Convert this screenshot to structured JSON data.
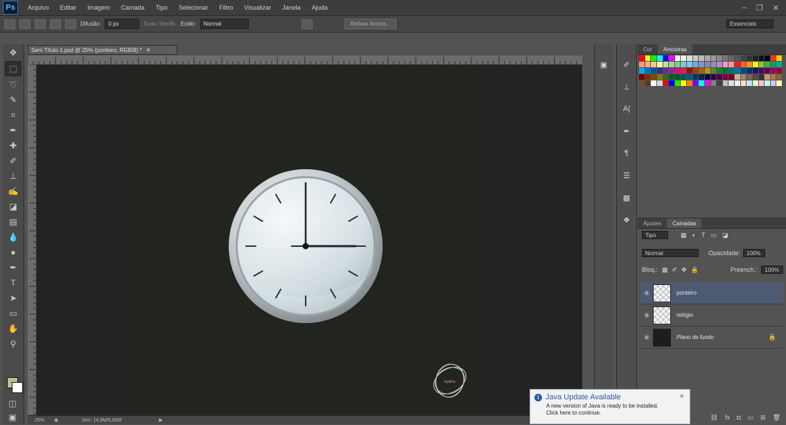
{
  "app": {
    "logo": "Ps"
  },
  "menubar": {
    "items": [
      "Arquivo",
      "Editar",
      "Imagem",
      "Camada",
      "Tipo",
      "Selecionar",
      "Filtro",
      "Visualizar",
      "Janela",
      "Ajuda"
    ]
  },
  "options": {
    "feather_label": "Difusão:",
    "feather_value": "0 px",
    "antialias_label": "Suav. Serrilh.",
    "style_label": "Estilo:",
    "style_value": "Normal",
    "refine_button": "Refinar Aresta...",
    "workspace": "Essenciais"
  },
  "document": {
    "tab_title": "Sem Título-1.psd @ 25% (ponteiro, RGB/8) *",
    "status_zoom": "25%",
    "status_doc": "Doc: 14,9M/5,00M"
  },
  "swatches": {
    "tabs": [
      "Cor",
      "Amostras"
    ],
    "colors": [
      "#ff0000",
      "#ffff00",
      "#00ff00",
      "#00ffff",
      "#0000ff",
      "#ff00ff",
      "#ffffff",
      "#eeeeee",
      "#dddddd",
      "#cccccc",
      "#bbbbbb",
      "#aaaaaa",
      "#999999",
      "#888888",
      "#777777",
      "#666666",
      "#555555",
      "#444444",
      "#333333",
      "#222222",
      "#111111",
      "#000000",
      "#ff3300",
      "#ffcc00",
      "#f7977a",
      "#f9ad81",
      "#fdc68a",
      "#fff79a",
      "#c4df9b",
      "#a2d39c",
      "#82ca9d",
      "#7bcdc8",
      "#6ecff6",
      "#7ea7d8",
      "#8493ca",
      "#8882be",
      "#a187be",
      "#bc8dbf",
      "#f49ac2",
      "#f6989d",
      "#ed1c24",
      "#f26522",
      "#f7941d",
      "#fff200",
      "#8dc73f",
      "#39b54a",
      "#00a651",
      "#00a99d",
      "#00aeef",
      "#0072bc",
      "#0054a6",
      "#2e3192",
      "#662d91",
      "#92278f",
      "#ec008c",
      "#ed145b",
      "#9e0b0f",
      "#a0410d",
      "#a36209",
      "#aba000",
      "#598527",
      "#1a7b30",
      "#007236",
      "#00746b",
      "#0076a3",
      "#004b80",
      "#003471",
      "#1b1464",
      "#440e62",
      "#630460",
      "#9e005d",
      "#9e0039",
      "#790000",
      "#7b2e00",
      "#7d4900",
      "#827b00",
      "#406618",
      "#005e20",
      "#005826",
      "#005952",
      "#005b7f",
      "#003663",
      "#002157",
      "#0d004c",
      "#32004b",
      "#4b0049",
      "#7b0046",
      "#7a0026",
      "#c7b299",
      "#998675",
      "#736357",
      "#534741",
      "#37302c",
      "#c69c6d",
      "#a67c52",
      "#8c6239",
      "#754c24",
      "#603913",
      "#ffffff",
      "#d7d7d7",
      "#ff0000",
      "#0000ff",
      "#00ff00",
      "#ffff00",
      "#ff8000",
      "#8000ff",
      "#00ffff",
      "#ff00ff",
      "#808080",
      "#404040",
      "#c0c0c0",
      "#e0e0e0",
      "#f0f0f0",
      "#ffe0c0",
      "#c0e0ff",
      "#e0ffc0",
      "#ffc0e0",
      "#c0ffe0",
      "#e0c0ff",
      "#ffffc0"
    ]
  },
  "layers_panel": {
    "tabs": [
      "Ajustes",
      "Camadas"
    ],
    "kind_filter": "Tipo",
    "blend_mode": "Normal",
    "opacity_label": "Opacidade:",
    "opacity_value": "100%",
    "lock_label": "Bloq.:",
    "fill_label": "Preench.:",
    "fill_value": "100%",
    "layers": [
      {
        "name": "ponteiro",
        "selected": true,
        "thumb": "transparent"
      },
      {
        "name": "relógio",
        "selected": false,
        "thumb": "transparent"
      },
      {
        "name": "Plano de fundo",
        "selected": false,
        "thumb": "dark",
        "locked": true
      }
    ]
  },
  "java_popup": {
    "title": "Java Update Available",
    "line1": "A new version of Java is ready to be installed.",
    "line2": "Click here to continue.",
    "close": "✕"
  },
  "canvas": {
    "logo_text": "ligafina"
  }
}
